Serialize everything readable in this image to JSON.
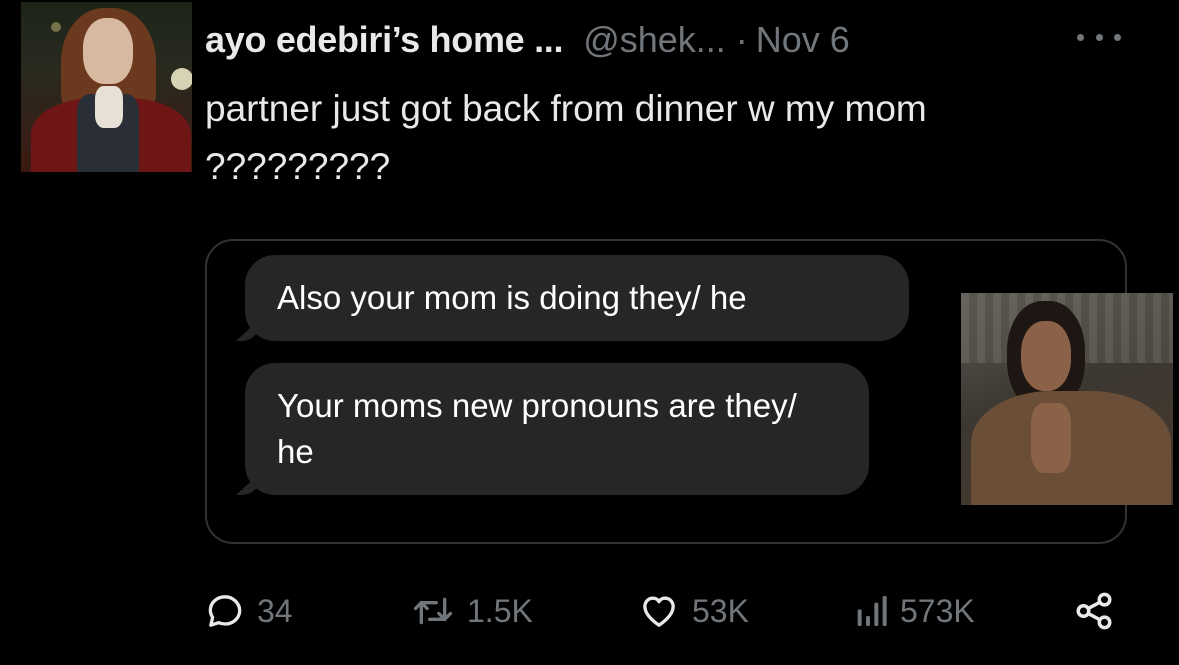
{
  "tweet": {
    "display_name": "ayo edebiri’s home ...",
    "handle": "@shek...",
    "separator": "·",
    "date": "Nov 6",
    "text": "partner just got back from dinner w my mom ?????????",
    "media": {
      "messages": [
        "Also your mom is doing they/  he",
        "Your moms new pronouns are they/  he"
      ]
    },
    "actions": {
      "replies": "34",
      "retweets": "1.5K",
      "likes": "53K",
      "views": "573K"
    }
  },
  "icons": {
    "more": "more-horizontal-icon",
    "reply": "reply-icon",
    "retweet": "retweet-icon",
    "like": "heart-icon",
    "views": "analytics-icon",
    "share": "share-icon"
  },
  "colors": {
    "background": "#000000",
    "primary_text": "#e7e9ea",
    "secondary_text": "#71767b",
    "bubble": "#262628",
    "border": "#2f3336"
  }
}
